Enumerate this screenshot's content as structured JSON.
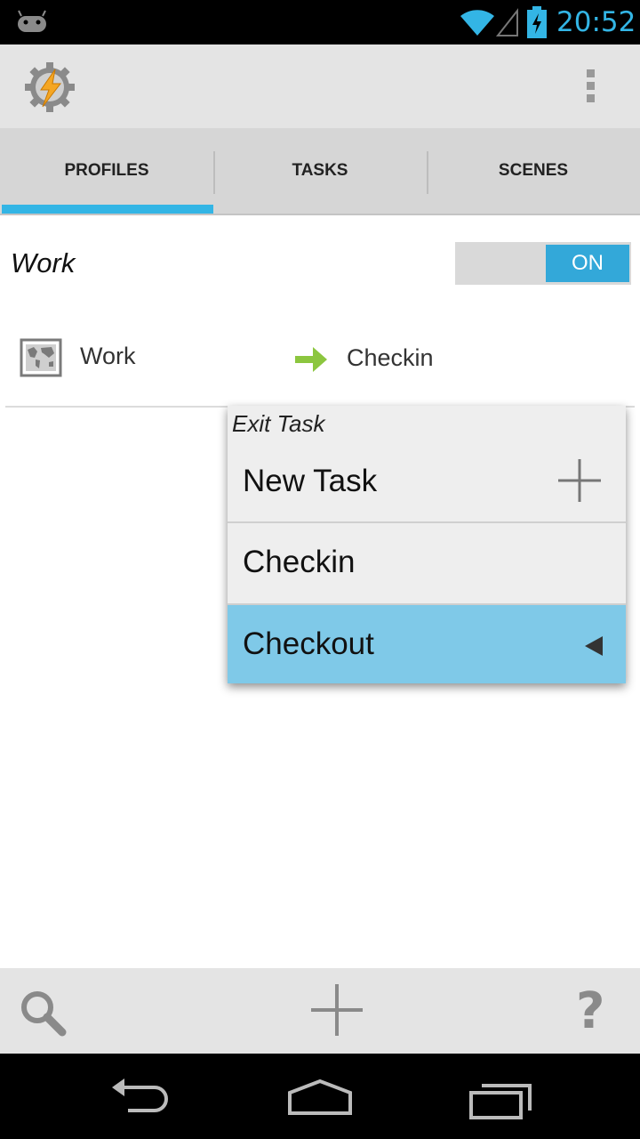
{
  "status_bar": {
    "time": "20:52",
    "accent_color": "#33b5e5",
    "icons": [
      "android-icon",
      "wifi-icon",
      "signal-icon",
      "battery-charging-icon"
    ]
  },
  "action_bar": {
    "app_icon": "tasker-gear-icon",
    "overflow_icon": "overflow-menu-icon"
  },
  "tabs": [
    {
      "label": "PROFILES",
      "selected": true
    },
    {
      "label": "TASKS",
      "selected": false
    },
    {
      "label": "SCENES",
      "selected": false
    }
  ],
  "profile": {
    "name": "Work",
    "toggle": "ON",
    "context_icon": "map-location-icon",
    "context_label": "Work",
    "task_icon": "enter-arrow-icon",
    "task_label": "Checkin"
  },
  "popup_menu": {
    "title": "Exit Task",
    "items": [
      {
        "label": "New Task",
        "icon": "plus-icon"
      },
      {
        "label": "Checkin"
      },
      {
        "label": "Checkout",
        "selected": true,
        "icon": "triangle-left-icon"
      }
    ],
    "highlight_color": "#7fc9e8"
  },
  "bottom_toolbar": {
    "icons": [
      "search-icon",
      "add-icon",
      "help-icon"
    ],
    "help_glyph": "?"
  },
  "navigation_bar": {
    "icons": [
      "back-icon",
      "home-icon",
      "recent-apps-icon"
    ]
  }
}
